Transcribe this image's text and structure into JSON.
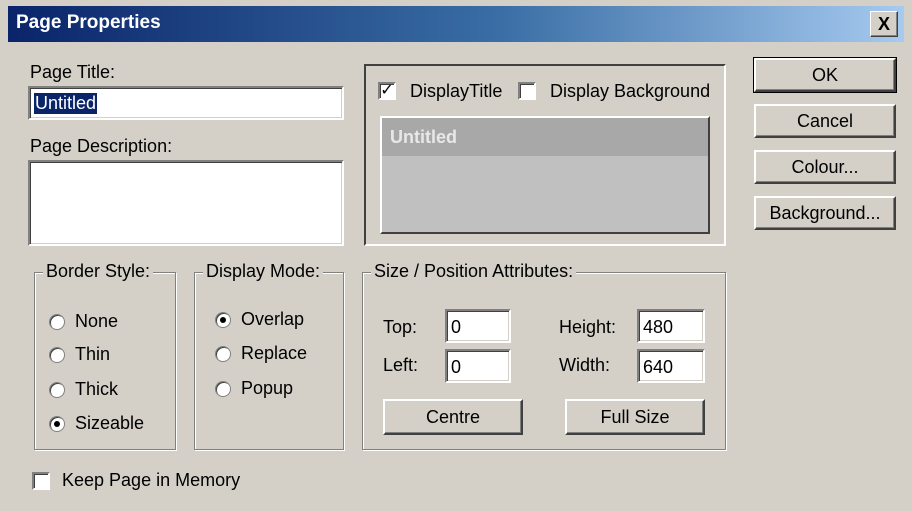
{
  "window": {
    "title": "Page Properties",
    "close_glyph": "X"
  },
  "page_title": {
    "label": "Page Title:",
    "value": "Untitled"
  },
  "page_description": {
    "label": "Page Description:",
    "value": ""
  },
  "display": {
    "title_check_label": "DisplayTitle",
    "title_checked": true,
    "background_check_label": "Display Background",
    "background_checked": false,
    "preview_title": "Untitled"
  },
  "buttons": {
    "ok": "OK",
    "cancel": "Cancel",
    "colour": "Colour...",
    "background": "Background..."
  },
  "border_style": {
    "title": "Border Style:",
    "options": [
      "None",
      "Thin",
      "Thick",
      "Sizeable"
    ],
    "selected": "Sizeable"
  },
  "display_mode": {
    "title": "Display Mode:",
    "options": [
      "Overlap",
      "Replace",
      "Popup"
    ],
    "selected": "Overlap"
  },
  "size_position": {
    "title": "Size / Position Attributes:",
    "top_label": "Top:",
    "top": "0",
    "left_label": "Left:",
    "left": "0",
    "height_label": "Height:",
    "height": "480",
    "width_label": "Width:",
    "width": "640",
    "centre_button": "Centre",
    "full_size_button": "Full Size"
  },
  "keep_in_memory": {
    "label": "Keep Page in Memory",
    "checked": false
  },
  "colors": {
    "title_bar_start": "#0a246a",
    "face": "#d4d0c8",
    "selection": "#0a246a"
  }
}
